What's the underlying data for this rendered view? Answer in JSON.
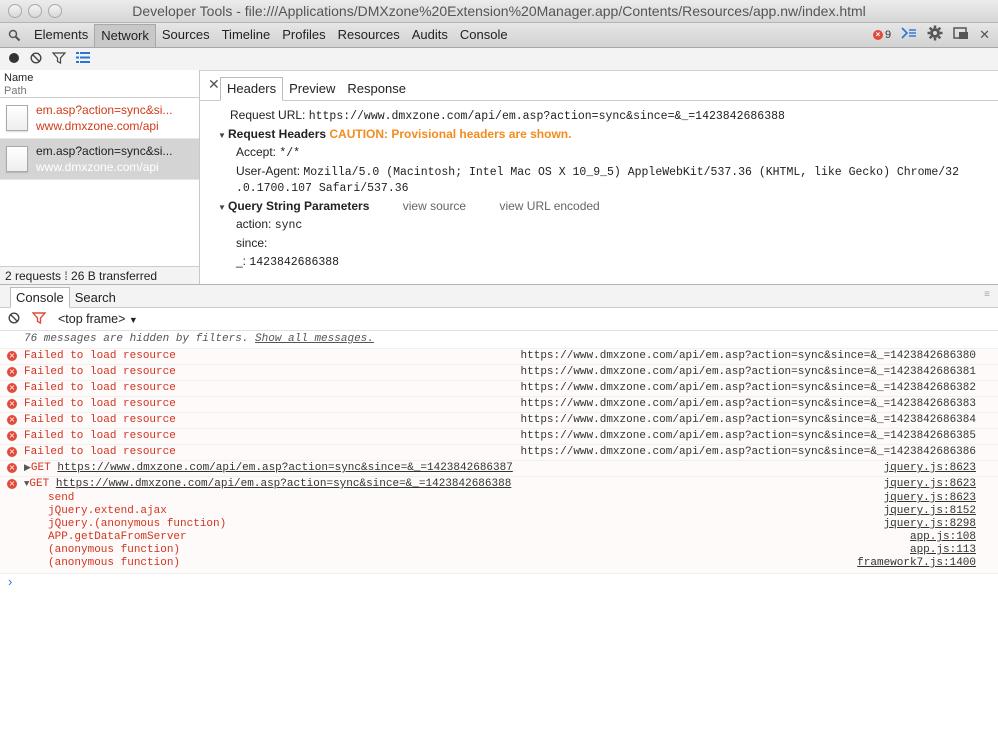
{
  "window": {
    "title": "Developer Tools - file:///Applications/DMXzone%20Extension%20Manager.app/Contents/Resources/app.nw/index.html"
  },
  "devtools_tabs": [
    "Elements",
    "Network",
    "Sources",
    "Timeline",
    "Profiles",
    "Resources",
    "Audits",
    "Console"
  ],
  "active_tab": "Network",
  "error_count": "9",
  "network": {
    "column_name": "Name",
    "column_path": "Path",
    "requests": [
      {
        "name": "em.asp?action=sync&si...",
        "path": "www.dmxzone.com/api"
      },
      {
        "name": "em.asp?action=sync&si...",
        "path": "www.dmxzone.com/api"
      }
    ],
    "status": "2 requests ⁞ 26 B transferred"
  },
  "details": {
    "tabs": [
      "Headers",
      "Preview",
      "Response"
    ],
    "request_url_label": "Request URL:",
    "request_url": "https://www.dmxzone.com/api/em.asp?action=sync&since=&_=1423842686388",
    "request_headers_label": "Request Headers",
    "caution": "CAUTION: Provisional headers are shown.",
    "accept_label": "Accept:",
    "accept_value": "*/*",
    "user_agent_label": "User-Agent:",
    "user_agent_value_1": "Mozilla/5.0 (Macintosh; Intel Mac OS X 10_9_5) AppleWebKit/537.36 (KHTML, like Gecko) Chrome/32",
    "user_agent_value_2": ".0.1700.107 Safari/537.36",
    "query_label": "Query String Parameters",
    "view_source": "view source",
    "view_url_encoded": "view URL encoded",
    "params": [
      {
        "key": "action:",
        "value": "sync"
      },
      {
        "key": "since:",
        "value": ""
      },
      {
        "key": "_:",
        "value": "1423842686388"
      }
    ]
  },
  "console": {
    "tabs": [
      "Console",
      "Search"
    ],
    "frame": "<top frame>",
    "hidden_text": "76 messages are hidden by filters.",
    "show_all": "Show all messages.",
    "failed_text": "Failed to load resource",
    "failed_urls": [
      "https://www.dmxzone.com/api/em.asp?action=sync&since=&_=1423842686380",
      "https://www.dmxzone.com/api/em.asp?action=sync&since=&_=1423842686381",
      "https://www.dmxzone.com/api/em.asp?action=sync&since=&_=1423842686382",
      "https://www.dmxzone.com/api/em.asp?action=sync&since=&_=1423842686383",
      "https://www.dmxzone.com/api/em.asp?action=sync&since=&_=1423842686384",
      "https://www.dmxzone.com/api/em.asp?action=sync&since=&_=1423842686385",
      "https://www.dmxzone.com/api/em.asp?action=sync&since=&_=1423842686386"
    ],
    "get1": {
      "method": "GET",
      "url": "https://www.dmxzone.com/api/em.asp?action=sync&since=&_=1423842686387",
      "src": "jquery.js:8623"
    },
    "get2": {
      "method": "GET",
      "url": "https://www.dmxzone.com/api/em.asp?action=sync&since=&_=1423842686388",
      "src": "jquery.js:8623"
    },
    "stack": [
      {
        "fn": "send",
        "src": "jquery.js:8623"
      },
      {
        "fn": "jQuery.extend.ajax",
        "src": "jquery.js:8152"
      },
      {
        "fn": "jQuery.(anonymous function)",
        "src": "jquery.js:8298"
      },
      {
        "fn": "APP.getDataFromServer",
        "src": "app.js:108"
      },
      {
        "fn": "(anonymous function)",
        "src": "app.js:113"
      },
      {
        "fn": "(anonymous function)",
        "src": "framework7.js:1400"
      }
    ],
    "prompt": "›"
  }
}
